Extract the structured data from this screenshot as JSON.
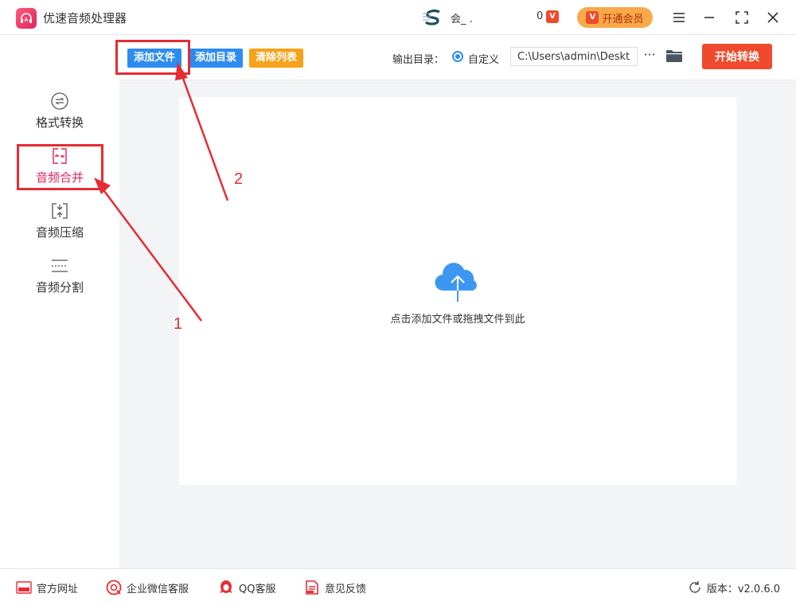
{
  "app": {
    "title": "优速音频处理器"
  },
  "user": {
    "name": "会_ .",
    "coins": "0",
    "coin_mark": "V",
    "vip_label": "开通会员"
  },
  "sidebar": {
    "items": [
      {
        "label": "格式转换",
        "icon": "format-convert-icon"
      },
      {
        "label": "音频合并",
        "icon": "audio-merge-icon",
        "active": true
      },
      {
        "label": "音频压缩",
        "icon": "audio-compress-icon"
      },
      {
        "label": "音频分割",
        "icon": "audio-split-icon"
      }
    ]
  },
  "toolbar": {
    "add_file": "添加文件",
    "add_folder": "添加目录",
    "clear_list": "清除列表",
    "output_label": "输出目录：",
    "custom_label": "自定义",
    "output_path": "C:\\Users\\admin\\Desktop",
    "more": "···",
    "start": "开始转换"
  },
  "dropzone": {
    "hint": "点击添加文件或拖拽文件到此"
  },
  "footer": {
    "website": "官方网址",
    "wecom": "企业微信客服",
    "qq": "QQ客服",
    "feedback": "意见反馈",
    "version": "版本：v2.0.6.0"
  },
  "annotations": {
    "step1": "1",
    "step2": "2"
  },
  "colors": {
    "accent_blue": "#2e8cf0",
    "accent_orange": "#f7a21b",
    "accent_red": "#f04a2c",
    "active_pink": "#e0245e",
    "annotation_red": "#e62c35"
  }
}
